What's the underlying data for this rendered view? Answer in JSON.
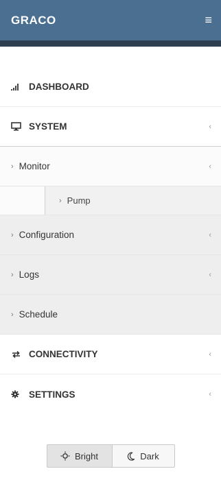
{
  "header": {
    "brand": "GRACO",
    "menu_icon": "hamburger-icon"
  },
  "nav": {
    "dashboard": {
      "label": "DASHBOARD",
      "icon": "signal-bars-icon"
    },
    "system": {
      "label": "SYSTEM",
      "icon": "monitor-icon",
      "chevron": "‹"
    },
    "system_items": {
      "monitor": {
        "label": "Monitor",
        "chevron": "‹"
      },
      "pump": {
        "label": "Pump"
      },
      "configuration": {
        "label": "Configuration",
        "chevron": "‹"
      },
      "logs": {
        "label": "Logs",
        "chevron": "‹"
      },
      "schedule": {
        "label": "Schedule"
      }
    },
    "connectivity": {
      "label": "CONNECTIVITY",
      "icon": "exchange-icon",
      "chevron": "‹"
    },
    "settings": {
      "label": "SETTINGS",
      "icon": "gear-icon",
      "chevron": "‹"
    }
  },
  "theme": {
    "bright_label": "Bright",
    "bright_icon": "sun-icon",
    "dark_label": "Dark",
    "dark_icon": "moon-icon"
  },
  "colors": {
    "header_bg": "#4b6f91",
    "header_border": "#2e3f4f"
  }
}
